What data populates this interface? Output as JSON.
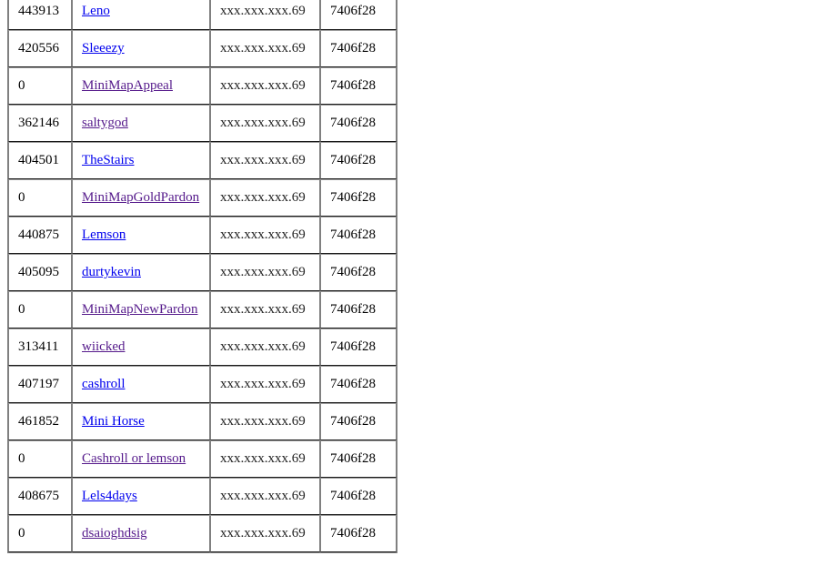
{
  "rows": [
    {
      "id": "443913",
      "name": "Leno",
      "ip": "xxx.xxx.xxx.69",
      "hash": "7406f28",
      "visited": false
    },
    {
      "id": "420556",
      "name": "Sleeezy",
      "ip": "xxx.xxx.xxx.69",
      "hash": "7406f28",
      "visited": false
    },
    {
      "id": "0",
      "name": "MiniMapAppeal",
      "ip": "xxx.xxx.xxx.69",
      "hash": "7406f28",
      "visited": true
    },
    {
      "id": "362146",
      "name": "saltygod",
      "ip": "xxx.xxx.xxx.69",
      "hash": "7406f28",
      "visited": true
    },
    {
      "id": "404501",
      "name": "TheStairs",
      "ip": "xxx.xxx.xxx.69",
      "hash": "7406f28",
      "visited": false
    },
    {
      "id": "0",
      "name": "MiniMapGoldPardon",
      "ip": "xxx.xxx.xxx.69",
      "hash": "7406f28",
      "visited": true
    },
    {
      "id": "440875",
      "name": "Lemson",
      "ip": "xxx.xxx.xxx.69",
      "hash": "7406f28",
      "visited": false
    },
    {
      "id": "405095",
      "name": "durtykevin",
      "ip": "xxx.xxx.xxx.69",
      "hash": "7406f28",
      "visited": false
    },
    {
      "id": "0",
      "name": "MiniMapNewPardon",
      "ip": "xxx.xxx.xxx.69",
      "hash": "7406f28",
      "visited": true
    },
    {
      "id": "313411",
      "name": "wiicked",
      "ip": "xxx.xxx.xxx.69",
      "hash": "7406f28",
      "visited": true
    },
    {
      "id": "407197",
      "name": "cashroll",
      "ip": "xxx.xxx.xxx.69",
      "hash": "7406f28",
      "visited": false
    },
    {
      "id": "461852",
      "name": "Mini Horse",
      "ip": "xxx.xxx.xxx.69",
      "hash": "7406f28",
      "visited": false
    },
    {
      "id": "0",
      "name": "Cashroll or lemson",
      "ip": "xxx.xxx.xxx.69",
      "hash": "7406f28",
      "visited": true
    },
    {
      "id": "408675",
      "name": "Lels4days",
      "ip": "xxx.xxx.xxx.69",
      "hash": "7406f28",
      "visited": false
    },
    {
      "id": "0",
      "name": "dsaioghdsig",
      "ip": "xxx.xxx.xxx.69",
      "hash": "7406f28",
      "visited": true
    }
  ],
  "colors": {
    "link": "#0000ee",
    "visited_link": "#551a8b",
    "border": "#808080"
  }
}
